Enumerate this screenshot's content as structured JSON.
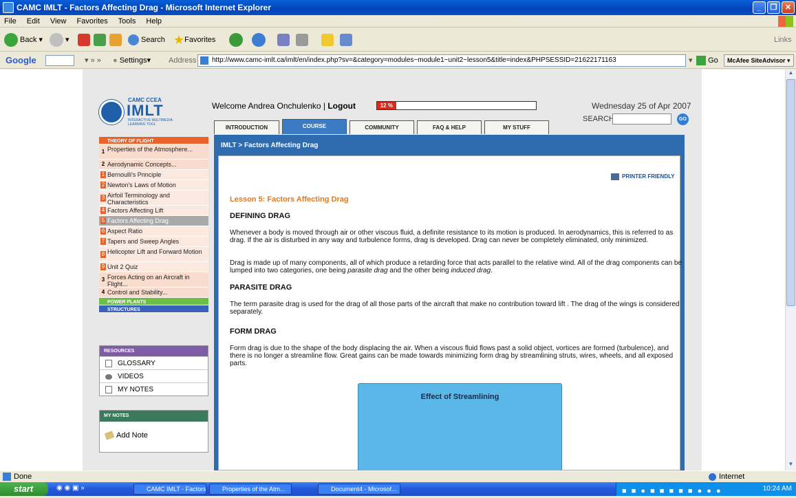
{
  "window": {
    "title": "CAMC IMLT - Factors Affecting Drag - Microsoft Internet Explorer"
  },
  "menu": [
    "File",
    "Edit",
    "View",
    "Favorites",
    "Tools",
    "Help"
  ],
  "toolbar": {
    "back": "Back",
    "search": "Search",
    "favorites": "Favorites",
    "links": "Links"
  },
  "googlebar": {
    "google": "Google",
    "settings": "Settings",
    "address_label": "Address",
    "url": "http://www.camc-imlt.ca/imlt/en/index.php?sv=&category=modules~module1~unit2~lesson5&title=index&PHPSESSID=21622171163",
    "go": "Go",
    "mcafee": "McAfee SiteAdvisor"
  },
  "site": {
    "logo_top": "CAMC CCEA",
    "logo_main": "IMLT",
    "logo_sub": "INTERACTIVE MULTIMEDIA LEARNING TOOL",
    "welcome": "Welcome Andrea Onchulenko | ",
    "logout": "Logout",
    "progress_label": "12 %",
    "progress_pct": 12,
    "date": "Wednesday 25 of Apr 2007",
    "search_label": "SEARCH",
    "go_label": "GO",
    "tabs": [
      "INTRODUCTION",
      "COURSE",
      "COMMUNITY",
      "FAQ & HELP",
      "MY STUFF"
    ],
    "breadcrumb": "IMLT > Factors Affecting Drag",
    "printer": "PRINTER FRIENDLY"
  },
  "nav": {
    "theory_head": "THEORY OF FLIGHT",
    "items": [
      {
        "num": "1",
        "label": "Properties of the Atmosphere...",
        "style": "plain"
      },
      {
        "num": "2",
        "label": "Aerodynamic Concepts...",
        "style": "plain"
      },
      {
        "num": "1",
        "label": "Bernoulli's Principle",
        "style": "sub"
      },
      {
        "num": "2",
        "label": "Newton's Laws of Motion",
        "style": "sub"
      },
      {
        "num": "3",
        "label": "Airfoil Terminology and Characteristics",
        "style": "sub"
      },
      {
        "num": "4",
        "label": "Factors Affecting Lift",
        "style": "sub"
      },
      {
        "num": "5",
        "label": "Factors Affecting Drag",
        "style": "active"
      },
      {
        "num": "6",
        "label": "Aspect Ratio",
        "style": "sub"
      },
      {
        "num": "7",
        "label": "Tapers and Sweep Angles",
        "style": "sub"
      },
      {
        "num": "8",
        "label": "Helicopter Lift and Forward Motion",
        "style": "sub"
      },
      {
        "num": "9",
        "label": "Unit 2 Quiz",
        "style": "sub"
      },
      {
        "num": "3",
        "label": "Forces Acting on an Aircraft in Flight...",
        "style": "plain"
      },
      {
        "num": "4",
        "label": "Control and Stability...",
        "style": "plain"
      }
    ],
    "power_head": "POWER PLANTS",
    "struct_head": "STRUCTURES"
  },
  "resources": {
    "head": "RESOURCES",
    "items": [
      "GLOSSARY",
      "VIDEOS",
      "MY NOTES"
    ]
  },
  "mynotes": {
    "head": "MY NOTES",
    "add": "Add Note"
  },
  "lesson": {
    "title": "Lesson 5: Factors Affecting Drag",
    "h_defining": "DEFINING DRAG",
    "p1": "Whenever a body is moved through air or other viscous fluid, a definite resistance to its motion is produced. In aerodynamics, this is referred to as drag. If the air is disturbed in any way and turbulence forms, drag is developed. Drag can never be completely eliminated, only minimized.",
    "p2a": "Drag is made up of many components, all of which produce a retarding force that acts parallel to the relative wind. All of the drag components can be lumped into two categories, one being ",
    "p2b": "parasite drag",
    "p2c": " and the other being ",
    "p2d": "induced drag",
    "p2e": ".",
    "h_parasite": "PARASITE DRAG",
    "p3": "The term parasite drag is used for the drag of all those parts of the aircraft that make no contribution toward lift . The drag of the wings is considered separately.",
    "h_form": "FORM DRAG",
    "p4": "Form drag is due to the shape of the body displacing the air. When a viscous fluid flows past a solid object, vortices are formed (turbulence), and there is no longer a streamline flow. Great gains can be made towards minimizing form drag by streamlining struts, wires, wheels, and all exposed parts.",
    "figure_title": "Effect of Streamlining"
  },
  "status": {
    "left": "Done",
    "zone": "Internet"
  },
  "taskbar": {
    "start": "start",
    "tasks": [
      "CAMC IMLT - Factors ...",
      "Properties of the Atm...",
      "Document4 - Microsof..."
    ],
    "clock": "10:24 AM"
  }
}
